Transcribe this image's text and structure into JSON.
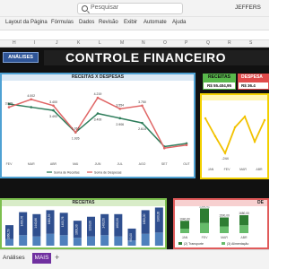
{
  "window": {
    "search_placeholder": "Pesquisar",
    "user_name": "JEFFERS"
  },
  "ribbon": {
    "tabs": [
      "Layout da Página",
      "Fórmulas",
      "Dados",
      "Revisão",
      "Exibir",
      "Automate",
      "Ajuda"
    ]
  },
  "grid": {
    "columns": [
      "H",
      "I",
      "J",
      "K",
      "L",
      "M",
      "N",
      "O",
      "P",
      "Q",
      "R",
      "S"
    ]
  },
  "dashboard": {
    "analises_button": "ANÁLISES",
    "title": "CONTROLE FINANCEIRO",
    "receitas_label": "RECEITAS",
    "receitas_value": "R$ 55.404,95",
    "despesas_label": "DESPESA",
    "despesas_value": "R$ 36.4",
    "panel_receitas_despesas": "RECEITAS X DESPESAS",
    "panel_receitas": "RECEITAS",
    "panel_despesas": "DE"
  },
  "chart_data": [
    {
      "type": "line",
      "title": "RECEITAS X DESPESAS",
      "categories": [
        "FEV",
        "MAR",
        "ABR",
        "MAI",
        "JUN",
        "JUL",
        "AGO",
        "SET",
        "OUT"
      ],
      "series": [
        {
          "name": "Soma de Receitas",
          "color": "#2e7d5b",
          "values": [
            3.8,
            3.6,
            3.4,
            2.0,
            3.2,
            2.9,
            2.6,
            1.1,
            1.3
          ],
          "labels": [
            "",
            "",
            "3.493",
            "1.926",
            "3.400",
            "2.906",
            "2.614",
            "",
            ""
          ]
        },
        {
          "name": "Soma de Despesas",
          "color": "#e06666",
          "values": [
            3.6,
            4.1,
            3.7,
            2.0,
            4.2,
            3.5,
            3.7,
            1.0,
            1.2
          ],
          "labels": [
            "3.829",
            "4.002",
            "3.400",
            "1.916",
            "4.219",
            "3.554",
            "3.750",
            "",
            ""
          ]
        }
      ],
      "legend": "bottom"
    },
    {
      "type": "line",
      "title": "",
      "categories": [
        "JAN",
        "FEV",
        "MAR",
        "ABR"
      ],
      "series": [
        {
          "name": "",
          "color": "#f2c200",
          "values": [
            -50,
            -150,
            -244,
            -100,
            -40,
            -180,
            -60
          ]
        }
      ],
      "point_labels": [
        "-244"
      ]
    },
    {
      "type": "bar",
      "title": "RECEITAS",
      "categories": [
        "JAN",
        "FEV",
        "MAR",
        "ABR",
        "MAI",
        "JUN",
        "JUL",
        "AGO",
        "SET",
        "OUT",
        "NOV",
        "DEZ"
      ],
      "series": [
        {
          "name": "top",
          "color": "#2f4f8f",
          "values": [
            1060,
            1750,
            1700,
            1800,
            1700,
            1300,
            1500,
            1600,
            1700,
            900,
            1800,
            1900
          ]
        },
        {
          "name": "base",
          "color": "#4f81bd",
          "values": [
            500,
            800,
            700,
            900,
            800,
            600,
            700,
            800,
            700,
            400,
            900,
            1000
          ]
        }
      ],
      "data_labels": [
        "1060,59",
        "1480,76",
        "1440,66",
        "1600,59",
        "1400,76",
        "1000,90",
        "1200,00",
        "1400,50",
        "1600,50",
        "900,00",
        "1800,00",
        "1900,00"
      ]
    },
    {
      "type": "bar",
      "title": "DE",
      "categories": [
        "JAN",
        "FEV",
        "MAR",
        "ABR"
      ],
      "series": [
        {
          "name": "(2) Transporte",
          "color": "#2e7d32",
          "values": [
            700,
            1300,
            800,
            900
          ]
        },
        {
          "name": "(3) Alimentação",
          "color": "#66bb6a",
          "values": [
            400,
            900,
            600,
            700
          ]
        }
      ],
      "data_labels": [
        "1040,60",
        "2500,01",
        "1500,00",
        "1680,00"
      ]
    }
  ],
  "sheets": {
    "tabs": [
      "Análises",
      "MAIS"
    ],
    "add_label": "+"
  }
}
